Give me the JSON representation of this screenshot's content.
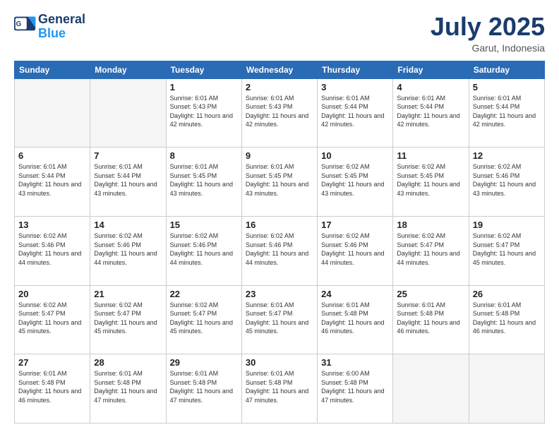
{
  "header": {
    "logo_line1": "General",
    "logo_line2": "Blue",
    "month": "July 2025",
    "location": "Garut, Indonesia"
  },
  "weekdays": [
    "Sunday",
    "Monday",
    "Tuesday",
    "Wednesday",
    "Thursday",
    "Friday",
    "Saturday"
  ],
  "weeks": [
    [
      {
        "day": "",
        "info": ""
      },
      {
        "day": "",
        "info": ""
      },
      {
        "day": "1",
        "info": "Sunrise: 6:01 AM\nSunset: 5:43 PM\nDaylight: 11 hours and 42 minutes."
      },
      {
        "day": "2",
        "info": "Sunrise: 6:01 AM\nSunset: 5:43 PM\nDaylight: 11 hours and 42 minutes."
      },
      {
        "day": "3",
        "info": "Sunrise: 6:01 AM\nSunset: 5:44 PM\nDaylight: 11 hours and 42 minutes."
      },
      {
        "day": "4",
        "info": "Sunrise: 6:01 AM\nSunset: 5:44 PM\nDaylight: 11 hours and 42 minutes."
      },
      {
        "day": "5",
        "info": "Sunrise: 6:01 AM\nSunset: 5:44 PM\nDaylight: 11 hours and 42 minutes."
      }
    ],
    [
      {
        "day": "6",
        "info": "Sunrise: 6:01 AM\nSunset: 5:44 PM\nDaylight: 11 hours and 43 minutes."
      },
      {
        "day": "7",
        "info": "Sunrise: 6:01 AM\nSunset: 5:44 PM\nDaylight: 11 hours and 43 minutes."
      },
      {
        "day": "8",
        "info": "Sunrise: 6:01 AM\nSunset: 5:45 PM\nDaylight: 11 hours and 43 minutes."
      },
      {
        "day": "9",
        "info": "Sunrise: 6:01 AM\nSunset: 5:45 PM\nDaylight: 11 hours and 43 minutes."
      },
      {
        "day": "10",
        "info": "Sunrise: 6:02 AM\nSunset: 5:45 PM\nDaylight: 11 hours and 43 minutes."
      },
      {
        "day": "11",
        "info": "Sunrise: 6:02 AM\nSunset: 5:45 PM\nDaylight: 11 hours and 43 minutes."
      },
      {
        "day": "12",
        "info": "Sunrise: 6:02 AM\nSunset: 5:46 PM\nDaylight: 11 hours and 43 minutes."
      }
    ],
    [
      {
        "day": "13",
        "info": "Sunrise: 6:02 AM\nSunset: 5:46 PM\nDaylight: 11 hours and 44 minutes."
      },
      {
        "day": "14",
        "info": "Sunrise: 6:02 AM\nSunset: 5:46 PM\nDaylight: 11 hours and 44 minutes."
      },
      {
        "day": "15",
        "info": "Sunrise: 6:02 AM\nSunset: 5:46 PM\nDaylight: 11 hours and 44 minutes."
      },
      {
        "day": "16",
        "info": "Sunrise: 6:02 AM\nSunset: 5:46 PM\nDaylight: 11 hours and 44 minutes."
      },
      {
        "day": "17",
        "info": "Sunrise: 6:02 AM\nSunset: 5:46 PM\nDaylight: 11 hours and 44 minutes."
      },
      {
        "day": "18",
        "info": "Sunrise: 6:02 AM\nSunset: 5:47 PM\nDaylight: 11 hours and 44 minutes."
      },
      {
        "day": "19",
        "info": "Sunrise: 6:02 AM\nSunset: 5:47 PM\nDaylight: 11 hours and 45 minutes."
      }
    ],
    [
      {
        "day": "20",
        "info": "Sunrise: 6:02 AM\nSunset: 5:47 PM\nDaylight: 11 hours and 45 minutes."
      },
      {
        "day": "21",
        "info": "Sunrise: 6:02 AM\nSunset: 5:47 PM\nDaylight: 11 hours and 45 minutes."
      },
      {
        "day": "22",
        "info": "Sunrise: 6:02 AM\nSunset: 5:47 PM\nDaylight: 11 hours and 45 minutes."
      },
      {
        "day": "23",
        "info": "Sunrise: 6:01 AM\nSunset: 5:47 PM\nDaylight: 11 hours and 45 minutes."
      },
      {
        "day": "24",
        "info": "Sunrise: 6:01 AM\nSunset: 5:48 PM\nDaylight: 11 hours and 46 minutes."
      },
      {
        "day": "25",
        "info": "Sunrise: 6:01 AM\nSunset: 5:48 PM\nDaylight: 11 hours and 46 minutes."
      },
      {
        "day": "26",
        "info": "Sunrise: 6:01 AM\nSunset: 5:48 PM\nDaylight: 11 hours and 46 minutes."
      }
    ],
    [
      {
        "day": "27",
        "info": "Sunrise: 6:01 AM\nSunset: 5:48 PM\nDaylight: 11 hours and 46 minutes."
      },
      {
        "day": "28",
        "info": "Sunrise: 6:01 AM\nSunset: 5:48 PM\nDaylight: 11 hours and 47 minutes."
      },
      {
        "day": "29",
        "info": "Sunrise: 6:01 AM\nSunset: 5:48 PM\nDaylight: 11 hours and 47 minutes."
      },
      {
        "day": "30",
        "info": "Sunrise: 6:01 AM\nSunset: 5:48 PM\nDaylight: 11 hours and 47 minutes."
      },
      {
        "day": "31",
        "info": "Sunrise: 6:00 AM\nSunset: 5:48 PM\nDaylight: 11 hours and 47 minutes."
      },
      {
        "day": "",
        "info": ""
      },
      {
        "day": "",
        "info": ""
      }
    ]
  ]
}
